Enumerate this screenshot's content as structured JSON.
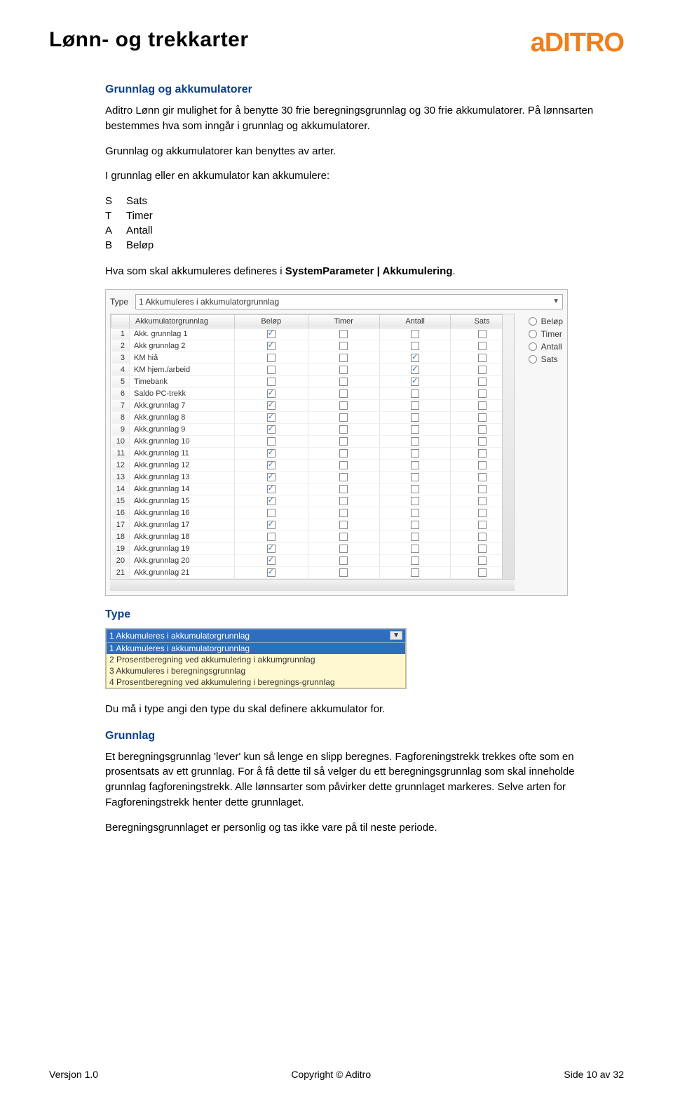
{
  "header": {
    "title": "Lønn- og trekkarter",
    "logo_text": "aDITRO",
    "logo_color": "#f07e1a"
  },
  "sections": {
    "s1_title": "Grunnlag og akkumulatorer",
    "s1_p1": "Aditro Lønn gir mulighet for å benytte 30 frie beregningsgrunnlag og 30 frie akkumulatorer. På lønnsarten bestemmes hva som inngår i grunnlag og akkumulatorer.",
    "s1_p2": "Grunnlag og akkumulatorer kan benyttes av arter.",
    "s1_p3": "I grunnlag eller en akkumulator kan akkumulere:",
    "defs": [
      {
        "k": "S",
        "v": "Sats"
      },
      {
        "k": "T",
        "v": "Timer"
      },
      {
        "k": "A",
        "v": "Antall"
      },
      {
        "k": "B",
        "v": "Beløp"
      }
    ],
    "s1_p4a": "Hva som skal akkumuleres defineres i ",
    "s1_p4b": "SystemParameter | Akkumulering",
    "s1_p4c": ".",
    "type_title": "Type",
    "type_p1": "Du må i type angi den type du skal definere akkumulator for.",
    "grunnlag_title": "Grunnlag",
    "grunnlag_p1": "Et beregningsgrunnlag 'lever' kun så lenge en slipp beregnes. Fagforeningstrekk trekkes ofte som en prosentsats av ett grunnlag. For å få dette til så velger du ett beregningsgrunnlag som skal inneholde grunnlag fagforeningstrekk. Alle lønnsarter som påvirker dette grunnlaget markeres. Selve arten for Fagforeningstrekk henter dette grunnlaget.",
    "grunnlag_p2": "Beregningsgrunnlaget er personlig og tas ikke vare på til neste periode."
  },
  "shot1": {
    "type_label": "Type",
    "type_value": "1 Akkumuleres i akkumulatorgrunnlag",
    "columns": [
      "",
      "Akkumulatorgrunnlag",
      "Beløp",
      "Timer",
      "Antall",
      "Sats"
    ],
    "radios": [
      "Beløp",
      "Timer",
      "Antall",
      "Sats"
    ],
    "rows": [
      {
        "n": "1",
        "name": "Akk. grunnlag 1",
        "b": true,
        "t": false,
        "a": false,
        "s": false
      },
      {
        "n": "2",
        "name": "Akk grunnlag 2",
        "b": true,
        "t": false,
        "a": false,
        "s": false
      },
      {
        "n": "3",
        "name": "KM hiå",
        "b": false,
        "t": false,
        "a": true,
        "s": false
      },
      {
        "n": "4",
        "name": "KM hjem./arbeid",
        "b": false,
        "t": false,
        "a": true,
        "s": false
      },
      {
        "n": "5",
        "name": "Timebank",
        "b": false,
        "t": false,
        "a": true,
        "s": false
      },
      {
        "n": "6",
        "name": "Saldo PC-trekk",
        "b": true,
        "t": false,
        "a": false,
        "s": false
      },
      {
        "n": "7",
        "name": "Akk.grunnlag 7",
        "b": true,
        "t": false,
        "a": false,
        "s": false
      },
      {
        "n": "8",
        "name": "Akk.grunnlag 8",
        "b": true,
        "t": false,
        "a": false,
        "s": false
      },
      {
        "n": "9",
        "name": "Akk.grunnlag 9",
        "b": true,
        "t": false,
        "a": false,
        "s": false
      },
      {
        "n": "10",
        "name": "Akk.grunnlag 10",
        "b": false,
        "t": false,
        "a": false,
        "s": false
      },
      {
        "n": "11",
        "name": "Akk.grunnlag 11",
        "b": true,
        "t": false,
        "a": false,
        "s": false
      },
      {
        "n": "12",
        "name": "Akk.grunnlag 12",
        "b": true,
        "t": false,
        "a": false,
        "s": false
      },
      {
        "n": "13",
        "name": "Akk.grunnlag 13",
        "b": true,
        "t": false,
        "a": false,
        "s": false
      },
      {
        "n": "14",
        "name": "Akk.grunnlag 14",
        "b": true,
        "t": false,
        "a": false,
        "s": false
      },
      {
        "n": "15",
        "name": "Akk.grunnlag 15",
        "b": true,
        "t": false,
        "a": false,
        "s": false
      },
      {
        "n": "16",
        "name": "Akk.grunnlag 16",
        "b": false,
        "t": false,
        "a": false,
        "s": false
      },
      {
        "n": "17",
        "name": "Akk.grunnlag 17",
        "b": true,
        "t": false,
        "a": false,
        "s": false
      },
      {
        "n": "18",
        "name": "Akk.grunnlag 18",
        "b": false,
        "t": false,
        "a": false,
        "s": false
      },
      {
        "n": "19",
        "name": "Akk.grunnlag 19",
        "b": true,
        "t": false,
        "a": false,
        "s": false
      },
      {
        "n": "20",
        "name": "Akk.grunnlag 20",
        "b": true,
        "t": false,
        "a": false,
        "s": false
      },
      {
        "n": "21",
        "name": "Akk.grunnlag 21",
        "b": true,
        "t": false,
        "a": false,
        "s": false
      }
    ]
  },
  "shot2": {
    "selected": "1 Akkumuleres i akkumulatorgrunnlag",
    "options": [
      "1 Akkumuleres i akkumulatorgrunnlag",
      "2 Prosentberegning ved akkumulering i akkumgrunnlag",
      "3 Akkumuleres i beregningsgrunnlag",
      "4 Prosentberegning ved akkumulering i beregnings-grunnlag"
    ]
  },
  "footer": {
    "left": "Versjon 1.0",
    "center": "Copyright © Aditro",
    "right": "Side 10 av 32"
  }
}
